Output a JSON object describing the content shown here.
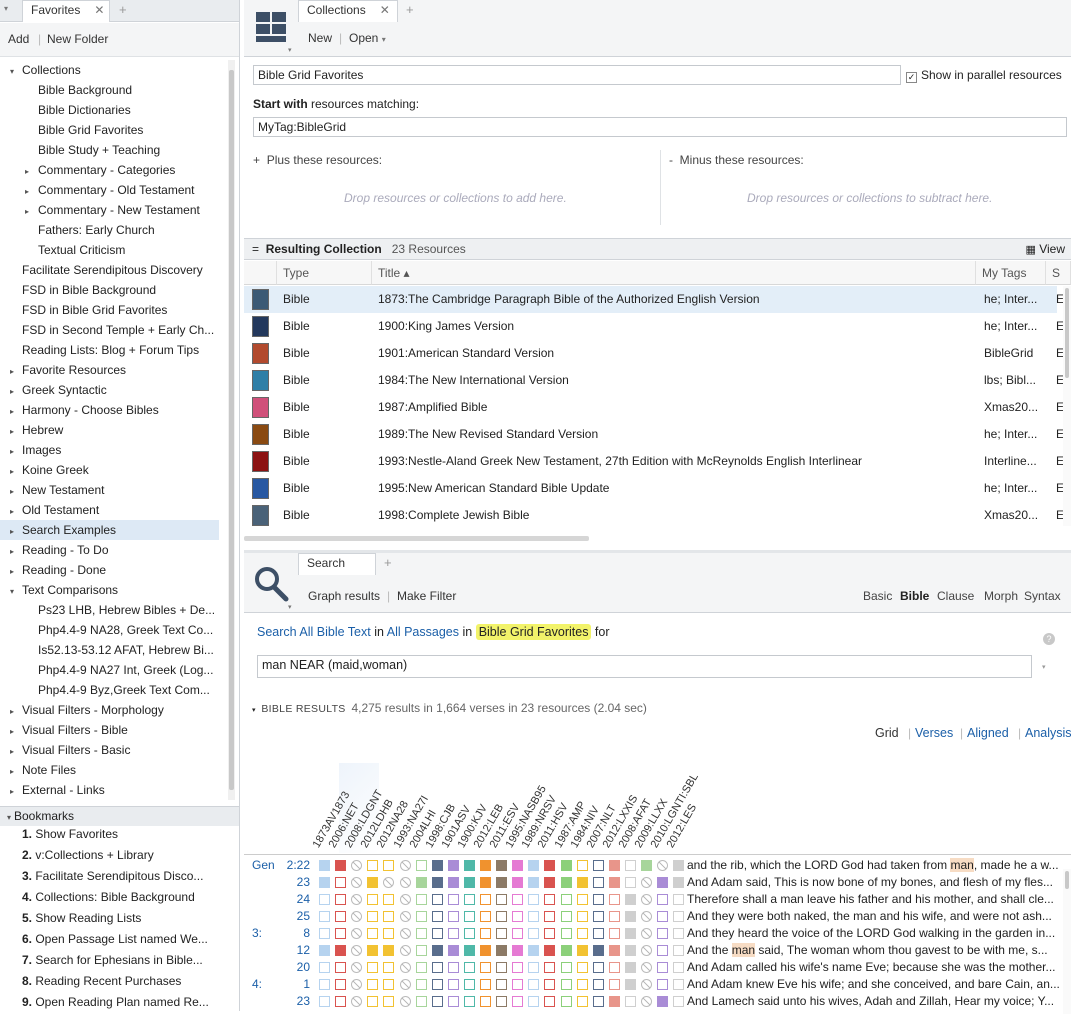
{
  "left": {
    "tab_label": "Favorites",
    "toolbar": {
      "add": "Add",
      "new_folder": "New Folder"
    },
    "tree": [
      {
        "label": "Collections",
        "level": 0,
        "tri": "▾"
      },
      {
        "label": "Bible Background",
        "level": 1,
        "tri": ""
      },
      {
        "label": "Bible Dictionaries",
        "level": 1,
        "tri": ""
      },
      {
        "label": "Bible Grid Favorites",
        "level": 1,
        "tri": ""
      },
      {
        "label": "Bible Study + Teaching",
        "level": 1,
        "tri": ""
      },
      {
        "label": "Commentary - Categories",
        "level": 1,
        "tri": "▸"
      },
      {
        "label": "Commentary - Old Testament",
        "level": 1,
        "tri": "▸"
      },
      {
        "label": "Commentary - New Testament",
        "level": 1,
        "tri": "▸"
      },
      {
        "label": "Fathers: Early Church",
        "level": 1,
        "tri": ""
      },
      {
        "label": "Textual Criticism",
        "level": 1,
        "tri": ""
      },
      {
        "label": "Facilitate Serendipitous Discovery",
        "level": 0,
        "tri": ""
      },
      {
        "label": "FSD in Bible Background",
        "level": 0,
        "tri": ""
      },
      {
        "label": "FSD in Bible Grid Favorites",
        "level": 0,
        "tri": ""
      },
      {
        "label": "FSD in Second Temple + Early Ch...",
        "level": 0,
        "tri": ""
      },
      {
        "label": "Reading Lists: Blog + Forum Tips",
        "level": 0,
        "tri": ""
      },
      {
        "label": "Favorite Resources",
        "level": 0,
        "tri": "▸"
      },
      {
        "label": "Greek Syntactic",
        "level": 0,
        "tri": "▸"
      },
      {
        "label": "Harmony - Choose Bibles",
        "level": 0,
        "tri": "▸"
      },
      {
        "label": "Hebrew",
        "level": 0,
        "tri": "▸"
      },
      {
        "label": "Images",
        "level": 0,
        "tri": "▸"
      },
      {
        "label": "Koine Greek",
        "level": 0,
        "tri": "▸"
      },
      {
        "label": "New Testament",
        "level": 0,
        "tri": "▸"
      },
      {
        "label": "Old Testament",
        "level": 0,
        "tri": "▸"
      },
      {
        "label": "Search Examples",
        "level": 0,
        "tri": "▸",
        "selected": true
      },
      {
        "label": "Reading - To Do",
        "level": 0,
        "tri": "▸"
      },
      {
        "label": "Reading - Done",
        "level": 0,
        "tri": "▸"
      },
      {
        "label": "Text Comparisons",
        "level": 0,
        "tri": "▾"
      },
      {
        "label": "Ps23 LHB, Hebrew Bibles + De...",
        "level": 1,
        "tri": ""
      },
      {
        "label": "Php4.4-9 NA28, Greek Text Co...",
        "level": 1,
        "tri": ""
      },
      {
        "label": "Is52.13-53.12 AFAT, Hebrew Bi...",
        "level": 1,
        "tri": ""
      },
      {
        "label": "Php4.4-9 NA27 Int, Greek (Log...",
        "level": 1,
        "tri": ""
      },
      {
        "label": "Php4.4-9 Byz,Greek Text Com...",
        "level": 1,
        "tri": ""
      },
      {
        "label": "Visual Filters - Morphology",
        "level": 0,
        "tri": "▸"
      },
      {
        "label": "Visual Filters - Bible",
        "level": 0,
        "tri": "▸"
      },
      {
        "label": "Visual Filters - Basic",
        "level": 0,
        "tri": "▸"
      },
      {
        "label": "Note Files",
        "level": 0,
        "tri": "▸"
      },
      {
        "label": "External - Links",
        "level": 0,
        "tri": "▸"
      }
    ],
    "bookmarks_title": "Bookmarks",
    "bookmarks": [
      {
        "num": "1.",
        "label": "Show Favorites"
      },
      {
        "num": "2.",
        "label": "v:Collections + Library"
      },
      {
        "num": "3.",
        "label": "Facilitate Serendipitous Disco..."
      },
      {
        "num": "4.",
        "label": "Collections: Bible Background"
      },
      {
        "num": "5.",
        "label": "Show Reading Lists"
      },
      {
        "num": "6.",
        "label": "Open Passage List named We..."
      },
      {
        "num": "7.",
        "label": "Search for Ephesians in Bible..."
      },
      {
        "num": "8.",
        "label": "Reading Recent Purchases"
      },
      {
        "num": "9.",
        "label": "Open Reading Plan named Re..."
      }
    ]
  },
  "collections": {
    "tab_label": "Collections",
    "toolbar": {
      "new": "New",
      "open": "Open"
    },
    "name_value": "Bible Grid Favorites",
    "show_parallel": "Show in parallel resources",
    "start_with_bold": "Start with",
    "start_with_rest": " resources matching:",
    "rule_value": "MyTag:BibleGrid",
    "plus_label": "Plus these resources:",
    "minus_label": "Minus these resources:",
    "plus_hint": "Drop resources or collections to add here.",
    "minus_hint": "Drop resources or collections to subtract here.",
    "result_title": "Resulting Collection",
    "result_count": "23 Resources",
    "view_label": "View",
    "columns": {
      "type": "Type",
      "title": "Title ▴",
      "tags": "My Tags",
      "s": "S"
    },
    "rows": [
      {
        "type": "Bible",
        "title": "1873:The Cambridge Paragraph Bible of the Authorized English Version",
        "tags": "he; Inter...",
        "s": "E",
        "cover": "#3c5a75"
      },
      {
        "type": "Bible",
        "title": "1900:King James Version",
        "tags": "he; Inter...",
        "s": "E",
        "cover": "#23385c"
      },
      {
        "type": "Bible",
        "title": "1901:American Standard Version",
        "tags": "BibleGrid",
        "s": "E",
        "cover": "#b24a2e"
      },
      {
        "type": "Bible",
        "title": "1984:The New International Version",
        "tags": "lbs; Bibl...",
        "s": "E",
        "cover": "#2f7fa7"
      },
      {
        "type": "Bible",
        "title": "1987:Amplified Bible",
        "tags": "Xmas20...",
        "s": "E",
        "cover": "#d0507a"
      },
      {
        "type": "Bible",
        "title": "1989:The New Revised Standard Version",
        "tags": "he; Inter...",
        "s": "E",
        "cover": "#8a4a12"
      },
      {
        "type": "Bible",
        "title": "1993:Nestle-Aland Greek New Testament, 27th Edition with McReynolds English Interlinear",
        "tags": "Interline...",
        "s": "E",
        "cover": "#8c1212"
      },
      {
        "type": "Bible",
        "title": "1995:New American Standard Bible Update",
        "tags": "he; Inter...",
        "s": "E",
        "cover": "#2858a2"
      },
      {
        "type": "Bible",
        "title": "1998:Complete Jewish Bible",
        "tags": "Xmas20...",
        "s": "E",
        "cover": "#4a6278"
      }
    ]
  },
  "search": {
    "tab_label": "Search",
    "toolbar": {
      "graph": "Graph results",
      "filter": "Make Filter"
    },
    "modes": [
      "Basic",
      "Bible",
      "Clause",
      "Morph",
      "Syntax"
    ],
    "active_mode": "Bible",
    "scope": {
      "search_in": "Search All Bible Text",
      "in1": " in ",
      "passages": "All Passages",
      "in2": " in ",
      "collection": "Bible Grid Favorites",
      "for": " for"
    },
    "query": "man NEAR (maid,woman)",
    "results_label": "BIBLE RESULTS",
    "results_summary": "4,275 results in 1,664 verses in 23 resources (2.04 sec)",
    "views": [
      "Grid",
      "Verses",
      "Aligned",
      "Analysis"
    ],
    "grid_columns": [
      "1873AV1873",
      "2006:NET",
      "2008:LDGNT",
      "2012LDHB",
      "2012NA28",
      "1993:NA27I",
      "2004LHI",
      "1998:CJB",
      "1901ASV",
      "1900:KJV",
      "2012:LEB",
      "2011:ESV",
      "1995:NASB95",
      "1989:NRSV",
      "2011:HSV",
      "1987:AMP",
      "1984:NIV",
      "2007:NLT",
      "2012:LXXIS",
      "2008:AFAT",
      "2009:LLXX",
      "2010:LGNTI:SBL",
      "2012:LES"
    ],
    "grid_colors": [
      "#b6d3ef",
      "#d9534f",
      "#cfcfcf",
      "#f2c232",
      "#f2c232",
      "#cfcfcf",
      "#a7d59b",
      "#596d8c",
      "#a98cd6",
      "#4fb8a8",
      "#f0922e",
      "#8c7a66",
      "#e57ad3",
      "#b6d3ef",
      "#d9534f",
      "#8cd07a",
      "#f2c232",
      "#596d8c",
      "#e8958a",
      "#cfcfcf",
      "#a7d59b",
      "#a98cd6",
      "#cfcfcf"
    ],
    "verses": [
      {
        "book": "Gen",
        "ref": "2:22",
        "pattern": "FFNEENEFFFFFFFFFEEFEFNF",
        "text": "and the rib, which the LORD God had taken from ",
        "m1": "man",
        "rest": ", made he a w..."
      },
      {
        "book": "",
        "ref": "23",
        "pattern": "FENFNNFFFFFFFFFFFEFENFF",
        "text": "And Adam said, This is now bone of my bones, and flesh of my fles...",
        "m1": "",
        "rest": ""
      },
      {
        "book": "",
        "ref": "24",
        "pattern": "EENEENEEEEEEEEEEEEEFNEE",
        "text": "Therefore shall a man leave his father and his mother, and shall cle...",
        "m1": "",
        "rest": ""
      },
      {
        "book": "",
        "ref": "25",
        "pattern": "EENEENEEEEEEEEEEEEEFNEE",
        "text": "And they were both naked, the man and his wife, and were not ash...",
        "m1": "",
        "rest": ""
      },
      {
        "book": "3:",
        "ref": "8",
        "pattern": "EENEENEEEEEEEEEEEEEFNEE",
        "text": "And they heard the voice of the LORD God walking in the garden in...",
        "m1": "",
        "rest": ""
      },
      {
        "book": "",
        "ref": "12",
        "pattern": "FFNFFNEFFFFFFFFFFFFFNEE",
        "text": "And the ",
        "m1": "man",
        "rest": " said, The woman whom thou gavest to be with me, s..."
      },
      {
        "book": "",
        "ref": "20",
        "pattern": "EENEENEEEEEEEEEEEEEFNEE",
        "text": "And Adam called his wife's name Eve; because she was the mother...",
        "m1": "",
        "rest": ""
      },
      {
        "book": "4:",
        "ref": "1",
        "pattern": "EENEENEEEEEEEEEEEEEFNEE",
        "text": "And Adam knew Eve his wife; and she conceived, and bare Cain, an...",
        "m1": "",
        "rest": ""
      },
      {
        "book": "",
        "ref": "23",
        "pattern": "EENEENEEEEEEEEEEEEFENFE",
        "text": "And Lamech said unto his wives, Adah and Zillah, Hear my voice; Y...",
        "m1": "",
        "rest": ""
      }
    ]
  }
}
